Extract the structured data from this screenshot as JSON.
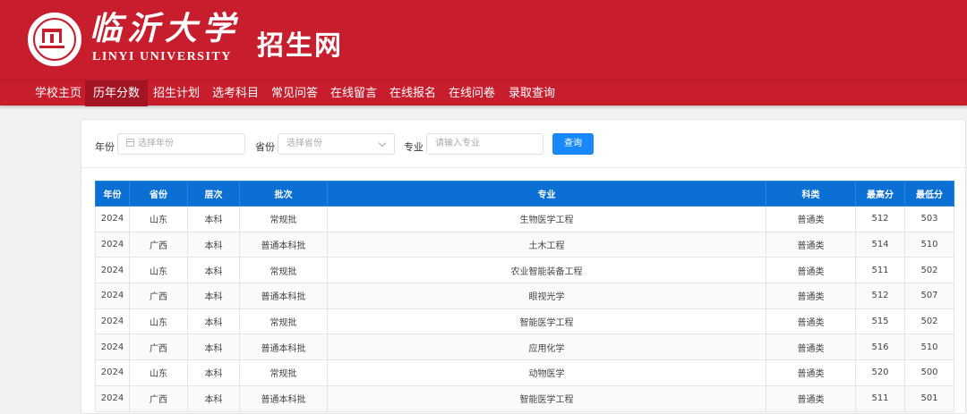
{
  "header": {
    "university_cn": "临沂大学",
    "university_en": "LINYI UNIVERSITY",
    "site_title": "招生网",
    "logo_icon": "university-seal-icon"
  },
  "nav": {
    "items": [
      {
        "label": "学校主页"
      },
      {
        "label": "历年分数",
        "active": true
      },
      {
        "label": "招生计划"
      },
      {
        "label": "选考科目"
      },
      {
        "label": "常见问答"
      },
      {
        "label": "在线留言"
      },
      {
        "label": "在线报名"
      },
      {
        "label": "在线问卷"
      },
      {
        "label": "录取查询"
      }
    ]
  },
  "filters": {
    "year_label": "年份",
    "year_placeholder": "选择年份",
    "province_label": "省份",
    "province_placeholder": "选择省份",
    "major_label": "专业",
    "major_placeholder": "请输入专业",
    "search_label": "查询"
  },
  "table": {
    "columns": [
      "年份",
      "省份",
      "层次",
      "批次",
      "专业",
      "科类",
      "最高分",
      "最低分"
    ],
    "rows": [
      [
        "2024",
        "山东",
        "本科",
        "常规批",
        "生物医学工程",
        "普通类",
        "512",
        "503"
      ],
      [
        "2024",
        "广西",
        "本科",
        "普通本科批",
        "土木工程",
        "普通类",
        "514",
        "510"
      ],
      [
        "2024",
        "山东",
        "本科",
        "常规批",
        "农业智能装备工程",
        "普通类",
        "511",
        "502"
      ],
      [
        "2024",
        "广西",
        "本科",
        "普通本科批",
        "眼视光学",
        "普通类",
        "512",
        "507"
      ],
      [
        "2024",
        "山东",
        "本科",
        "常规批",
        "智能医学工程",
        "普通类",
        "515",
        "502"
      ],
      [
        "2024",
        "广西",
        "本科",
        "普通本科批",
        "应用化学",
        "普通类",
        "516",
        "510"
      ],
      [
        "2024",
        "山东",
        "本科",
        "常规批",
        "动物医学",
        "普通类",
        "520",
        "500"
      ],
      [
        "2024",
        "广西",
        "本科",
        "普通本科批",
        "智能医学工程",
        "普通类",
        "511",
        "501"
      ]
    ]
  },
  "colors": {
    "brand_red": "#c81d2c",
    "table_header_blue": "#0b6fd4",
    "button_blue": "#1989fa"
  }
}
